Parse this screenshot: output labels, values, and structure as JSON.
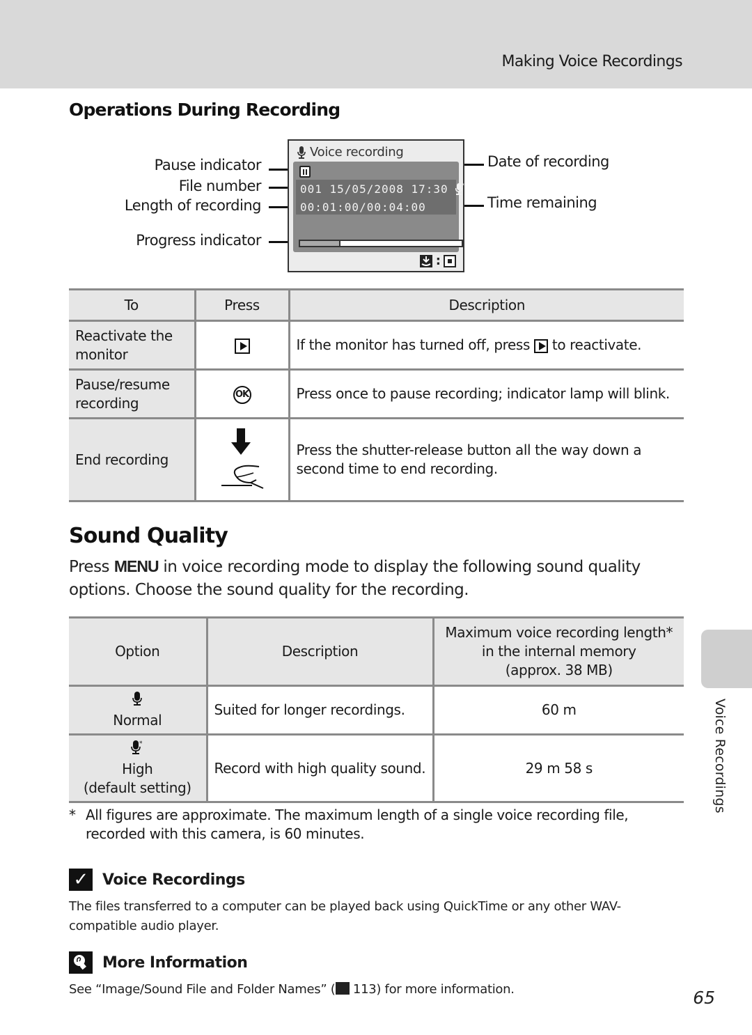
{
  "header": {
    "title": "Making Voice Recordings"
  },
  "operations": {
    "title": "Operations During Recording",
    "diagram": {
      "left_labels": [
        "Pause indicator",
        "File number",
        "Length of recording",
        "Progress indicator"
      ],
      "right_labels": [
        "Date of recording",
        "Time remaining"
      ],
      "screen": {
        "title": "Voice recording",
        "file_and_date": "001  15/05/2008  17:30",
        "length_line": "00:01:00/00:04:00",
        "progress_fraction": 0.25,
        "bottom_icon_label": ":"
      }
    },
    "table": {
      "headers": [
        "To",
        "Press",
        "Description"
      ],
      "rows": [
        {
          "to": "Reactivate the monitor",
          "press_icon": "playback-button-icon",
          "description_before": "If the monitor has turned off, press",
          "description_after": "to reactivate."
        },
        {
          "to": "Pause/resume recording",
          "press_icon": "ok-button-icon",
          "press_text": "OK",
          "description": "Press once to pause recording; indicator lamp will blink."
        },
        {
          "to": "End recording",
          "press_icon": "shutter-release-press-icon",
          "description": "Press the shutter-release button all the way down a second time to end recording."
        }
      ]
    }
  },
  "sound_quality": {
    "title": "Sound Quality",
    "intro_before": "Press",
    "intro_key": "MENU",
    "intro_after": "in voice recording mode to display the following sound quality options. Choose the sound quality for the recording.",
    "table": {
      "headers": [
        "Option",
        "Description",
        "Maximum voice recording length*",
        "in the internal memory",
        "(approx. 38 MB)"
      ],
      "rows": [
        {
          "icon": "microphone-normal-icon",
          "option": "Normal",
          "option_sub": "",
          "description": "Suited for longer recordings.",
          "length": "60 m"
        },
        {
          "icon": "microphone-high-icon",
          "option": "High",
          "option_sub": "(default setting)",
          "description": "Record with high quality sound.",
          "length": "29 m 58 s"
        }
      ]
    },
    "footnote_mark": "*",
    "footnote": "All figures are approximate. The maximum length of a single voice recording file, recorded with this camera, is 60 minutes."
  },
  "notes": [
    {
      "icon": "check-icon",
      "title": "Voice Recordings",
      "text": "The files transferred to a computer can be played back using QuickTime or any other WAV-compatible audio player."
    },
    {
      "icon": "lightbulb-icon",
      "title": "More Information",
      "text_before": "See “Image/Sound File and Folder Names” (",
      "ref_page": "113",
      "text_after": ") for more information."
    }
  ],
  "side_tab": {
    "label": "Voice Recordings"
  },
  "page_number": "65"
}
